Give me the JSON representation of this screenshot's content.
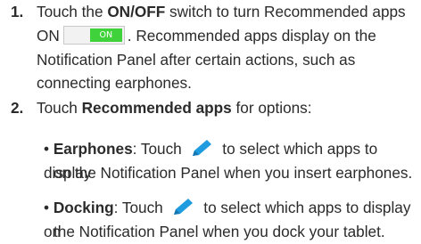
{
  "steps": [
    {
      "number": "1.",
      "line1_pre": "Touch the ",
      "line1_bold": "ON/OFF",
      "line1_post": " switch to turn Recommended apps",
      "line2_pre": "ON",
      "toggle_label": "ON",
      "line2_post": ". Recommended apps display on the",
      "line3": "Notification Panel after certain actions, such as",
      "line4": "connecting earphones."
    },
    {
      "number": "2.",
      "line1_pre": "Touch ",
      "line1_bold": "Recommended apps",
      "line1_post": " for options:"
    }
  ],
  "bullets": [
    {
      "marker": "•",
      "term": "Earphones",
      "text_pre": ": Touch ",
      "icon": "pencil-icon",
      "text_post": " to select which apps to display",
      "continuation": "on the Notification Panel when you insert earphones."
    },
    {
      "marker": "•",
      "term": "Docking",
      "text_pre": ": Touch ",
      "icon": "pencil-icon",
      "text_post": " to select which apps to display on",
      "continuation": "the Notification Panel when you dock your tablet."
    }
  ],
  "colors": {
    "toggle_on": "#3fd23a",
    "pencil": "#1f9be0",
    "text": "#2b2b2b"
  }
}
